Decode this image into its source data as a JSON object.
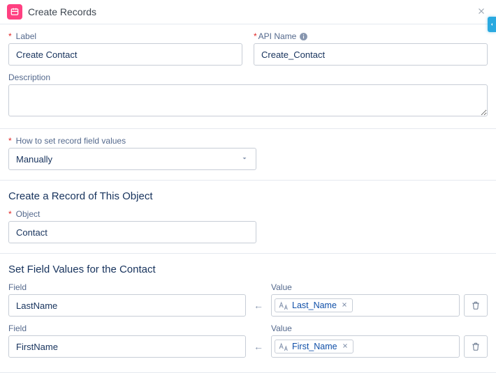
{
  "header": {
    "title": "Create Records"
  },
  "basics": {
    "label_label": "Label",
    "label_value": "Create Contact",
    "apiName_label": "API Name",
    "apiName_value": "Create_Contact",
    "description_label": "Description",
    "description_value": ""
  },
  "howSet": {
    "label": "How to set record field values",
    "value": "Manually"
  },
  "objectSection": {
    "heading": "Create a Record of This Object",
    "object_label": "Object",
    "object_value": "Contact"
  },
  "fieldValues": {
    "heading": "Set Field Values for the Contact",
    "field_label": "Field",
    "value_label": "Value",
    "rows": [
      {
        "field": "LastName",
        "value_token": "Last_Name"
      },
      {
        "field": "FirstName",
        "value_token": "First_Name"
      }
    ]
  }
}
